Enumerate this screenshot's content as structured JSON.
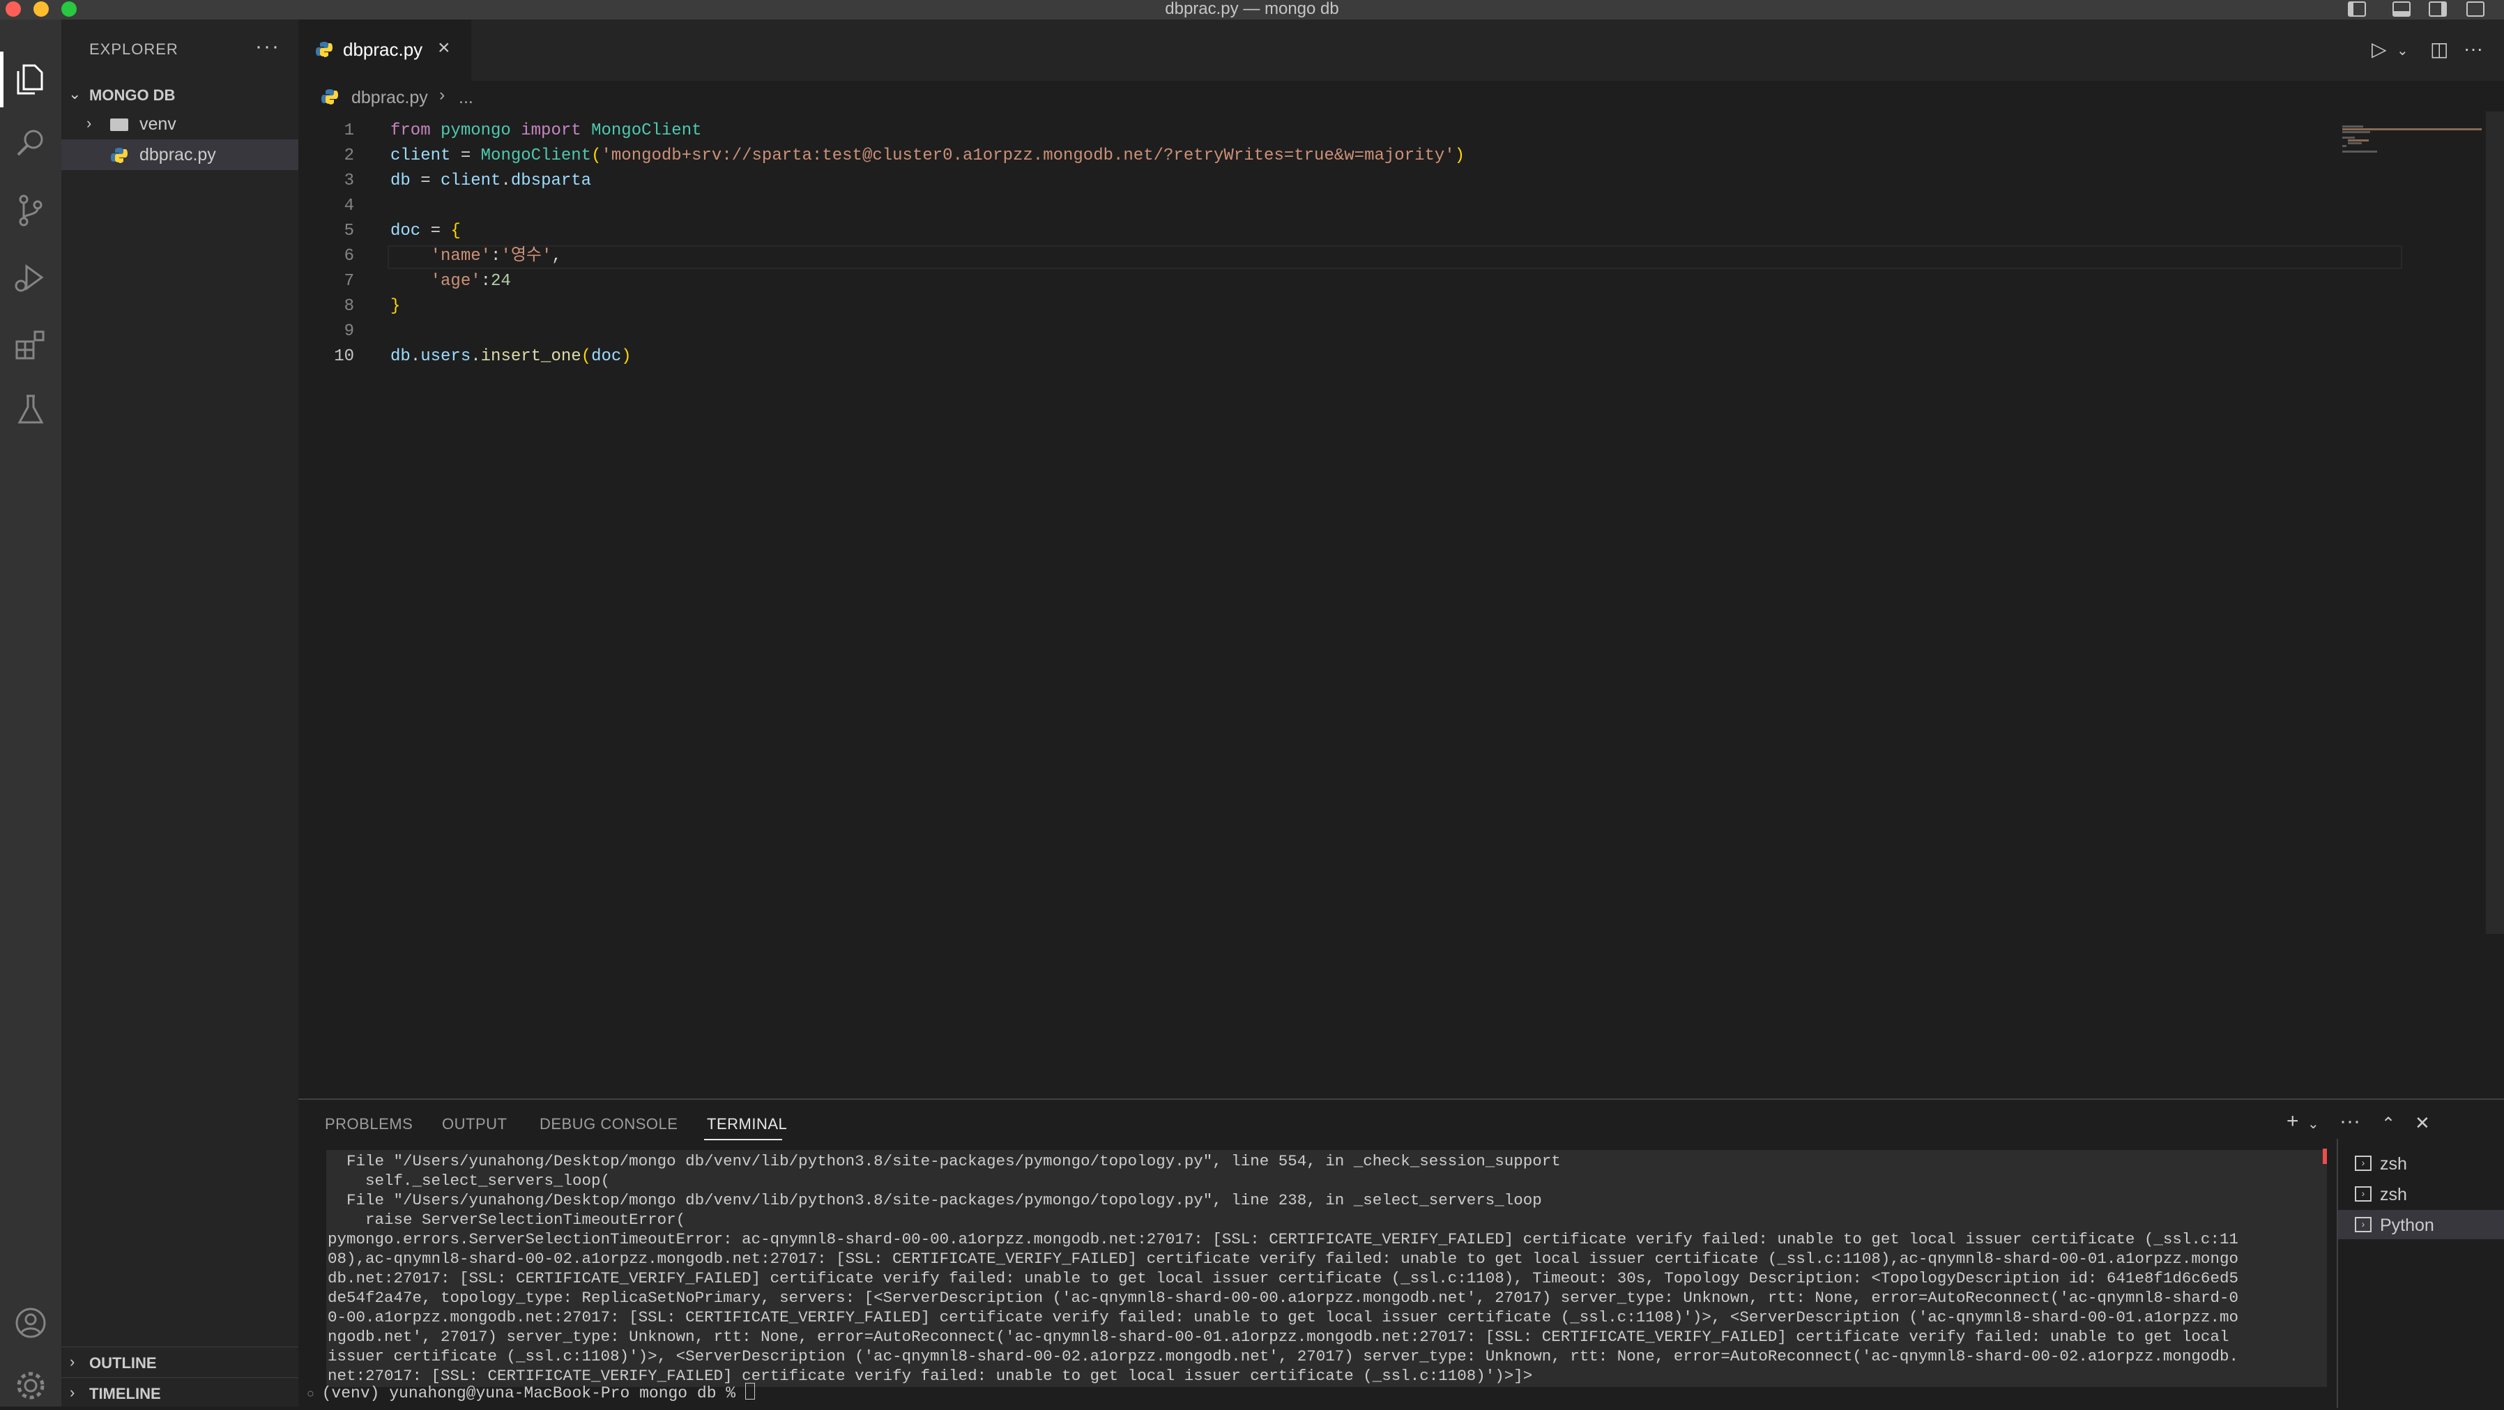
{
  "window": {
    "title": "dbprac.py — mongo db"
  },
  "sidebar": {
    "title": "EXPLORER",
    "more": "···",
    "section": "MONGO DB",
    "tree": [
      {
        "label": "venv",
        "type": "folder"
      },
      {
        "label": "dbprac.py",
        "type": "python-file"
      }
    ],
    "outline": "OUTLINE",
    "timeline": "TIMELINE"
  },
  "editor": {
    "tab": {
      "label": "dbprac.py",
      "close": "×"
    },
    "breadcrumb": {
      "file": "dbprac.py",
      "sep": "›",
      "rest": "..."
    },
    "lines": [
      {
        "n": "1",
        "tokens": [
          [
            "kw",
            "from"
          ],
          [
            "pl",
            " "
          ],
          [
            "cls",
            "pymongo"
          ],
          [
            "pl",
            " "
          ],
          [
            "kw",
            "import"
          ],
          [
            "pl",
            " "
          ],
          [
            "cls",
            "MongoClient"
          ]
        ]
      },
      {
        "n": "2",
        "tokens": [
          [
            "id",
            "client"
          ],
          [
            "pl",
            " = "
          ],
          [
            "cls",
            "MongoClient"
          ],
          [
            "br1",
            "("
          ],
          [
            "str",
            "'mongodb+srv://sparta:test@cluster0.a1orpzz.mongodb.net/?retryWrites=true&w=majority'"
          ],
          [
            "br1",
            ")"
          ]
        ]
      },
      {
        "n": "3",
        "tokens": [
          [
            "id",
            "db"
          ],
          [
            "pl",
            " = "
          ],
          [
            "id",
            "client"
          ],
          [
            "pl",
            "."
          ],
          [
            "id",
            "dbsparta"
          ]
        ]
      },
      {
        "n": "4",
        "tokens": []
      },
      {
        "n": "5",
        "tokens": [
          [
            "id",
            "doc"
          ],
          [
            "pl",
            " = "
          ],
          [
            "br1",
            "{"
          ]
        ]
      },
      {
        "n": "6",
        "tokens": [
          [
            "pl",
            "    "
          ],
          [
            "str",
            "'name'"
          ],
          [
            "pl",
            ":"
          ],
          [
            "str",
            "'영수'"
          ],
          [
            "pl",
            ","
          ]
        ]
      },
      {
        "n": "7",
        "tokens": [
          [
            "pl",
            "    "
          ],
          [
            "str",
            "'age'"
          ],
          [
            "pl",
            ":"
          ],
          [
            "num",
            "24"
          ]
        ]
      },
      {
        "n": "8",
        "tokens": [
          [
            "br1",
            "}"
          ]
        ]
      },
      {
        "n": "9",
        "tokens": []
      },
      {
        "n": "10",
        "tokens": [
          [
            "id",
            "db"
          ],
          [
            "pl",
            "."
          ],
          [
            "id",
            "users"
          ],
          [
            "pl",
            "."
          ],
          [
            "fn",
            "insert_one"
          ],
          [
            "br1",
            "("
          ],
          [
            "id",
            "doc"
          ],
          [
            "br1",
            ")"
          ]
        ]
      }
    ]
  },
  "panel": {
    "tabs": [
      "PROBLEMS",
      "OUTPUT",
      "DEBUG CONSOLE",
      "TERMINAL"
    ],
    "active_tab": "TERMINAL",
    "terminal_lines": [
      "  File \"/Users/yunahong/Desktop/mongo db/venv/lib/python3.8/site-packages/pymongo/topology.py\", line 554, in _check_session_support",
      "    self._select_servers_loop(",
      "  File \"/Users/yunahong/Desktop/mongo db/venv/lib/python3.8/site-packages/pymongo/topology.py\", line 238, in _select_servers_loop",
      "    raise ServerSelectionTimeoutError(",
      "pymongo.errors.ServerSelectionTimeoutError: ac-qnymnl8-shard-00-00.a1orpzz.mongodb.net:27017: [SSL: CERTIFICATE_VERIFY_FAILED] certificate verify failed: unable to get local issuer certificate (_ssl.c:11",
      "08),ac-qnymnl8-shard-00-02.a1orpzz.mongodb.net:27017: [SSL: CERTIFICATE_VERIFY_FAILED] certificate verify failed: unable to get local issuer certificate (_ssl.c:1108),ac-qnymnl8-shard-00-01.a1orpzz.mongo",
      "db.net:27017: [SSL: CERTIFICATE_VERIFY_FAILED] certificate verify failed: unable to get local issuer certificate (_ssl.c:1108), Timeout: 30s, Topology Description: <TopologyDescription id: 641e8f1d6c6ed5",
      "de54f2a47e, topology_type: ReplicaSetNoPrimary, servers: [<ServerDescription ('ac-qnymnl8-shard-00-00.a1orpzz.mongodb.net', 27017) server_type: Unknown, rtt: None, error=AutoReconnect('ac-qnymnl8-shard-0",
      "0-00.a1orpzz.mongodb.net:27017: [SSL: CERTIFICATE_VERIFY_FAILED] certificate verify failed: unable to get local issuer certificate (_ssl.c:1108)')>, <ServerDescription ('ac-qnymnl8-shard-00-01.a1orpzz.mo",
      "ngodb.net', 27017) server_type: Unknown, rtt: None, error=AutoReconnect('ac-qnymnl8-shard-00-01.a1orpzz.mongodb.net:27017: [SSL: CERTIFICATE_VERIFY_FAILED] certificate verify failed: unable to get local",
      "issuer certificate (_ssl.c:1108)')>, <ServerDescription ('ac-qnymnl8-shard-00-02.a1orpzz.mongodb.net', 27017) server_type: Unknown, rtt: None, error=AutoReconnect('ac-qnymnl8-shard-00-02.a1orpzz.mongodb.",
      "net:27017: [SSL: CERTIFICATE_VERIFY_FAILED] certificate verify failed: unable to get local issuer certificate (_ssl.c:1108)')>]>"
    ],
    "prompt": "(venv) yunahong@yuna-MacBook-Pro mongo db % ",
    "terminals": [
      "zsh",
      "zsh",
      "Python"
    ]
  },
  "colors": {
    "accent": "#007acc",
    "background": "#1e1e1e",
    "sidebar": "#252526"
  }
}
